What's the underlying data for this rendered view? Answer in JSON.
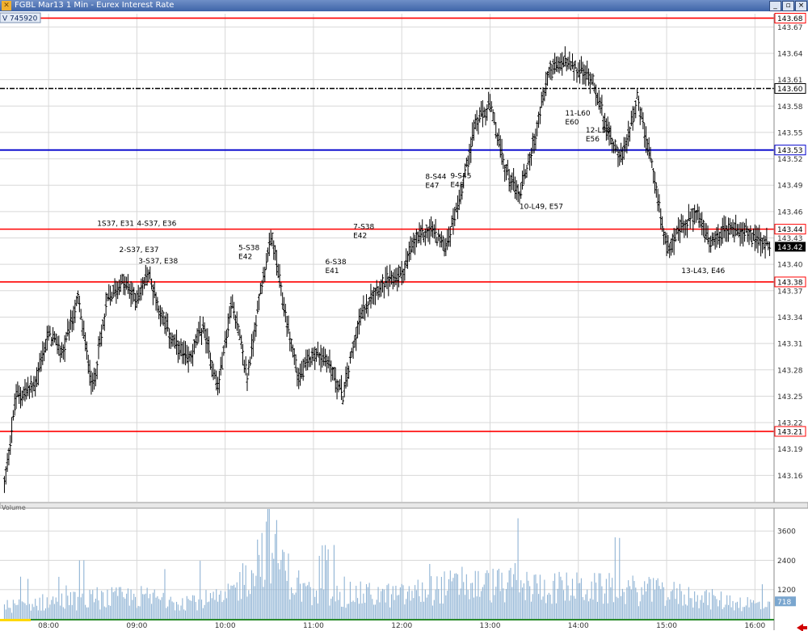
{
  "window": {
    "title": "FGBL Mar13 1 Min - Eurex Interest Rate",
    "buttons": [
      "_",
      "▫",
      "×"
    ]
  },
  "info_badge": "V  745920",
  "volume_pane_label": "Volume",
  "colors": {
    "price_bar": "#000000",
    "volume_bar": "#8fb3d4",
    "red_level": "#ff0000",
    "blue_level": "#0000cc",
    "dashed_level": "#000000",
    "grid": "#d8d8d8",
    "last_price_bg": "#000000"
  },
  "chart_data": [
    {
      "type": "ohlc",
      "instrument": "FGBL Mar13",
      "interval": "1 Min",
      "ylim": [
        143.13,
        143.685
      ],
      "xlim": [
        "07:27",
        "16:13"
      ],
      "x_ticks": [
        "08:00",
        "09:00",
        "10:00",
        "11:00",
        "12:00",
        "13:00",
        "14:00",
        "15:00",
        "16:00"
      ],
      "y_ticks": [
        143.16,
        143.19,
        143.22,
        143.25,
        143.28,
        143.31,
        143.34,
        143.37,
        143.4,
        143.43,
        143.46,
        143.49,
        143.52,
        143.55,
        143.58,
        143.61,
        143.64,
        143.67
      ],
      "grid": true,
      "last_price": 143.42,
      "price_path": [
        [
          "07:30",
          143.15
        ],
        [
          "07:38",
          143.25
        ],
        [
          "07:50",
          143.26
        ],
        [
          "08:00",
          143.32
        ],
        [
          "08:10",
          143.3
        ],
        [
          "08:20",
          143.36
        ],
        [
          "08:30",
          143.26
        ],
        [
          "08:40",
          143.36
        ],
        [
          "08:50",
          143.38
        ],
        [
          "09:00",
          143.36
        ],
        [
          "09:08",
          143.39
        ],
        [
          "09:15",
          143.35
        ],
        [
          "09:25",
          143.31
        ],
        [
          "09:35",
          143.29
        ],
        [
          "09:45",
          143.33
        ],
        [
          "09:55",
          143.26
        ],
        [
          "10:05",
          143.36
        ],
        [
          "10:15",
          143.27
        ],
        [
          "10:25",
          143.38
        ],
        [
          "10:32",
          143.43
        ],
        [
          "10:40",
          143.35
        ],
        [
          "10:50",
          143.27
        ],
        [
          "11:00",
          143.3
        ],
        [
          "11:10",
          143.29
        ],
        [
          "11:20",
          143.25
        ],
        [
          "11:30",
          143.33
        ],
        [
          "11:40",
          143.37
        ],
        [
          "11:50",
          143.38
        ],
        [
          "12:00",
          143.39
        ],
        [
          "12:10",
          143.43
        ],
        [
          "12:20",
          143.44
        ],
        [
          "12:30",
          143.42
        ],
        [
          "12:40",
          143.48
        ],
        [
          "12:50",
          143.56
        ],
        [
          "13:00",
          143.58
        ],
        [
          "13:10",
          143.51
        ],
        [
          "13:20",
          143.48
        ],
        [
          "13:30",
          143.54
        ],
        [
          "13:40",
          143.62
        ],
        [
          "13:50",
          143.63
        ],
        [
          "14:00",
          143.62
        ],
        [
          "14:10",
          143.61
        ],
        [
          "14:20",
          143.55
        ],
        [
          "14:30",
          143.52
        ],
        [
          "14:40",
          143.59
        ],
        [
          "14:50",
          143.51
        ],
        [
          "15:00",
          143.42
        ],
        [
          "15:10",
          143.44
        ],
        [
          "15:20",
          143.46
        ],
        [
          "15:30",
          143.42
        ],
        [
          "15:40",
          143.44
        ],
        [
          "15:50",
          143.44
        ],
        [
          "16:00",
          143.43
        ],
        [
          "16:10",
          143.42
        ]
      ],
      "levels": [
        {
          "label": "143.68",
          "value": 143.68,
          "style": "red"
        },
        {
          "label": "143.60",
          "value": 143.6,
          "style": "dashdot"
        },
        {
          "label": "143.53",
          "value": 143.53,
          "style": "blue"
        },
        {
          "label": "143.44",
          "value": 143.44,
          "style": "red"
        },
        {
          "label": "143.38",
          "value": 143.38,
          "style": "red"
        },
        {
          "label": "143.21",
          "value": 143.21,
          "style": "red"
        }
      ],
      "annotations": [
        {
          "lines": [
            "1S37, E31"
          ],
          "time": "08:33",
          "price": 143.444
        },
        {
          "lines": [
            "4-S37, E36"
          ],
          "time": "09:00",
          "price": 143.444
        },
        {
          "lines": [
            "2-S37, E37"
          ],
          "time": "08:48",
          "price": 143.414
        },
        {
          "lines": [
            "3-S37, E38"
          ],
          "time": "09:01",
          "price": 143.401
        },
        {
          "lines": [
            "5-S38",
            "E42"
          ],
          "time": "10:09",
          "price": 143.416
        },
        {
          "lines": [
            "6-S38",
            "E41"
          ],
          "time": "11:08",
          "price": 143.4
        },
        {
          "lines": [
            "7-S38",
            "E42"
          ],
          "time": "11:27",
          "price": 143.44
        },
        {
          "lines": [
            "8-S44",
            "E47"
          ],
          "time": "12:16",
          "price": 143.497
        },
        {
          "lines": [
            "9-S45",
            "E48"
          ],
          "time": "12:33",
          "price": 143.498
        },
        {
          "lines": [
            "10-L49, E57"
          ],
          "time": "13:20",
          "price": 143.463
        },
        {
          "lines": [
            "11-L60",
            "E60"
          ],
          "time": "13:51",
          "price": 143.569
        },
        {
          "lines": [
            "12-L58",
            "E56"
          ],
          "time": "14:05",
          "price": 143.55
        },
        {
          "lines": [
            "13-L43, E46"
          ],
          "time": "15:10",
          "price": 143.39
        }
      ]
    },
    {
      "type": "bar",
      "name": "Volume",
      "ylim": [
        0,
        4500
      ],
      "y_ticks": [
        1200,
        2400,
        3600
      ],
      "last_value": 718,
      "volume_path": [
        [
          "07:30",
          500
        ],
        [
          "08:00",
          700
        ],
        [
          "08:30",
          800
        ],
        [
          "09:00",
          900
        ],
        [
          "09:30",
          750
        ],
        [
          "10:00",
          800
        ],
        [
          "10:15",
          1800
        ],
        [
          "10:30",
          3200
        ],
        [
          "10:45",
          1600
        ],
        [
          "11:00",
          900
        ],
        [
          "11:30",
          1000
        ],
        [
          "12:00",
          950
        ],
        [
          "12:30",
          1300
        ],
        [
          "13:00",
          1400
        ],
        [
          "13:30",
          1300
        ],
        [
          "14:00",
          1250
        ],
        [
          "14:30",
          1200
        ],
        [
          "15:00",
          1050
        ],
        [
          "15:30",
          800
        ],
        [
          "16:00",
          600
        ],
        [
          "16:10",
          500
        ]
      ]
    }
  ]
}
